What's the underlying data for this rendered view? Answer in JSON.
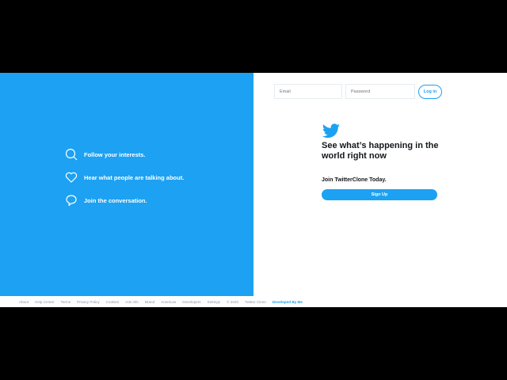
{
  "features": [
    {
      "icon": "search-icon",
      "label": "Follow your interests."
    },
    {
      "icon": "heart-icon",
      "label": "Hear what people are talking about."
    },
    {
      "icon": "speech-bubble-icon",
      "label": "Join the conversation."
    }
  ],
  "login": {
    "email_placeholder": "Email",
    "password_placeholder": "Password",
    "login_label": "Log in"
  },
  "main": {
    "headline": "See what’s happening in the world right now",
    "join_text": "Join TwitterClone Today.",
    "signup_label": "Sign Up"
  },
  "footer": {
    "links": [
      "About",
      "Help Center",
      "Terms",
      "Privacy Policy",
      "Cookies",
      "Ads info",
      "Brand",
      "Americas",
      "Developers",
      "Settings",
      "© 2020",
      "Twitter Clone"
    ],
    "developed_by": "Developed By Me"
  },
  "colors": {
    "brand": "#1da1f2"
  }
}
